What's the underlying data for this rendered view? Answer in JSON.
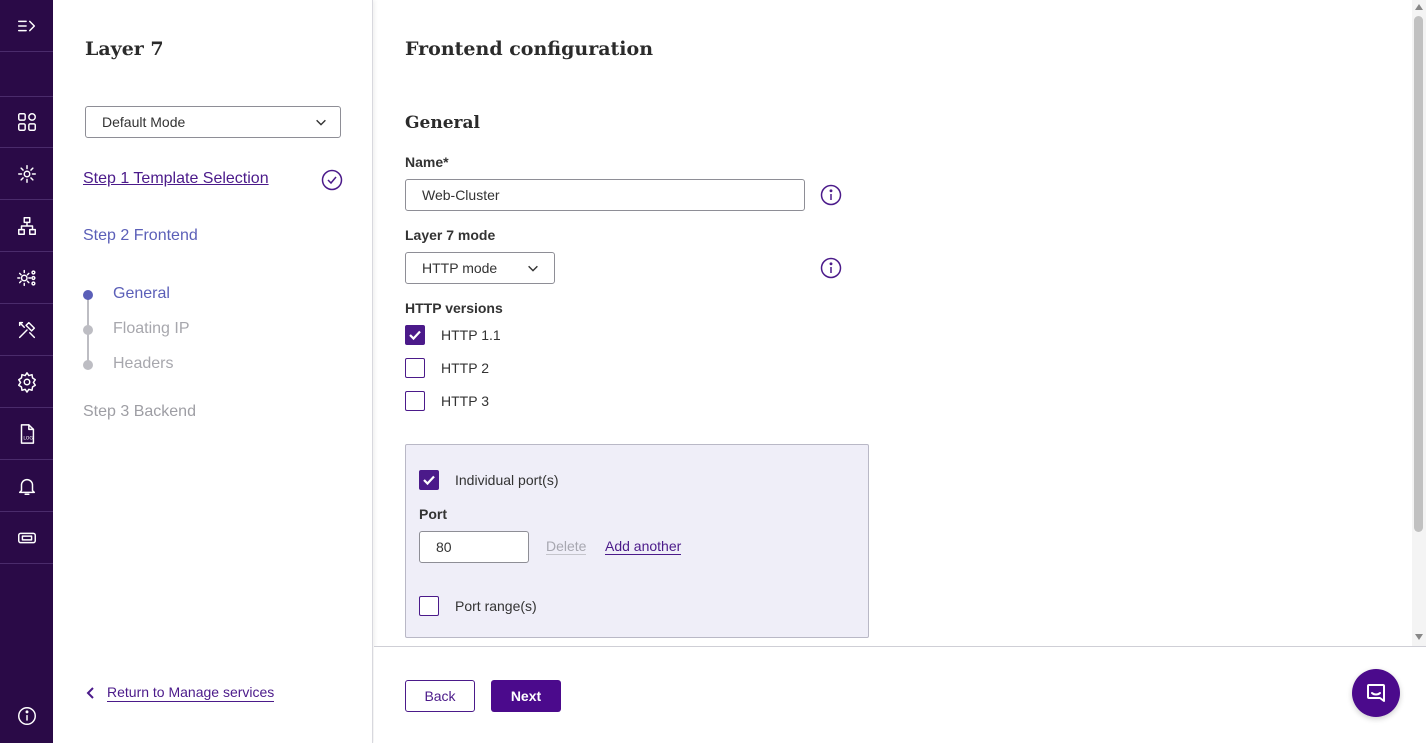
{
  "rail": {
    "icons": [
      "expand-icon",
      "dashboard-icon",
      "services-icon",
      "network-icon",
      "system-config-icon",
      "tools-icon",
      "settings-icon",
      "log-icon",
      "notifications-icon",
      "license-icon",
      "info-icon"
    ]
  },
  "wizard": {
    "title": "Layer 7",
    "mode": "Default Mode",
    "steps": {
      "step1": "Step 1 Template Selection",
      "step2": "Step 2 Frontend",
      "step3": "Step 3 Backend"
    },
    "substeps": [
      "General",
      "Floating IP",
      "Headers"
    ],
    "return_label": "Return to Manage services"
  },
  "main": {
    "title": "Frontend configuration",
    "section": "General",
    "name_label": "Name*",
    "name_value": "Web-Cluster",
    "mode_label": "Layer 7 mode",
    "mode_value": "HTTP mode",
    "versions_label": "HTTP versions",
    "versions": [
      {
        "label": "HTTP 1.1",
        "checked": true
      },
      {
        "label": "HTTP 2",
        "checked": false
      },
      {
        "label": "HTTP 3",
        "checked": false
      }
    ],
    "ports": {
      "individual_label": "Individual port(s)",
      "individual_checked": true,
      "port_label": "Port",
      "port_value": "80",
      "delete_label": "Delete",
      "add_label": "Add another",
      "range_label": "Port range(s)",
      "range_checked": false
    },
    "back_label": "Back",
    "next_label": "Next"
  },
  "colors": {
    "rail_bg": "#2a0a47",
    "accent": "#4b1a8a",
    "active_step": "#5b5fb8",
    "inactive_step": "#9e9ea4",
    "port_box_bg": "#efeef8"
  }
}
